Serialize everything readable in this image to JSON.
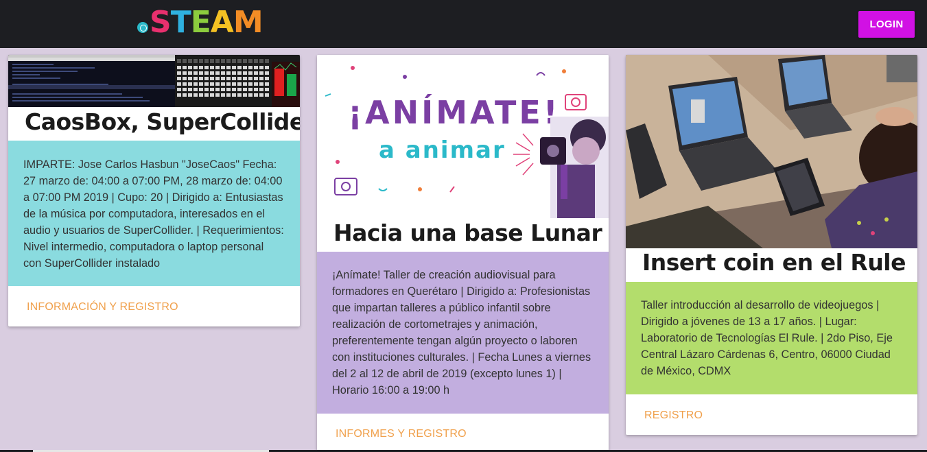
{
  "header": {
    "logo_letters": [
      "S",
      "T",
      "E",
      "A",
      "M"
    ],
    "login_label": "LOGIN"
  },
  "cards": [
    {
      "title": "CaosBox, SuperCollider",
      "body": "IMPARTE: Jose Carlos Hasbun \"JoseCaos\" Fecha: 27 marzo de: 04:00 a 07:00 PM, 28 marzo de: 04:00 a 07:00 PM 2019 | Cupo: 20 | Dirigido a: Entusiastas de la música por computadora, interesados en el audio y usuarios de SuperCollider. | Requerimientos: Nivel intermedio, computadora o laptop personal con SuperCollider instalado",
      "action": "INFORMACIÓN Y REGISTRO",
      "body_color": "#8adbdf"
    },
    {
      "title": "Hacia una base Lunar",
      "image_text": {
        "headline": "¡ANÍMATE!",
        "subline": "a animar"
      },
      "body": "¡Anímate! Taller de creación audiovisual para formadores en Querétaro | Dirigido a: Profesionistas que impartan talleres a público infantil sobre realización de cortometrajes y animación, preferentemente tengan algún proyecto o laboren con instituciones culturales. | Fecha Lunes a viernes del 2 al 12 de abril de 2019 (excepto lunes 1) | Horario 16:00 a 19:00 h",
      "action": "INFORMES Y REGISTRO",
      "body_color": "#c2aedf"
    },
    {
      "title": "Insert coin en el Rule",
      "body": "Taller introducción al desarrollo de videojuegos | Dirigido a jóvenes de 13 a 17 años. | Lugar: Laboratorio de Tecnologías El Rule. | 2do Piso, Eje Central Lázaro Cárdenas 6, Centro, 06000 Ciudad de México, CDMX",
      "action": "REGISTRO",
      "body_color": "#b3dd6c"
    }
  ],
  "colors": {
    "background": "#d9cde0",
    "header": "#1d1e22",
    "login_button": "#d111e4",
    "action_link": "#f0a04b"
  }
}
